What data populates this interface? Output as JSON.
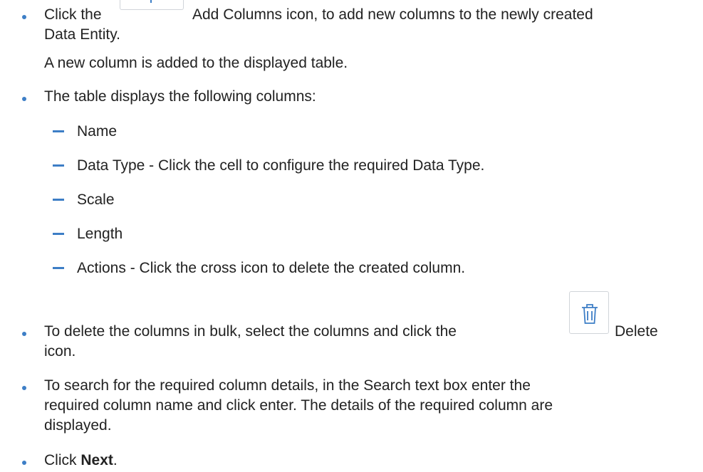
{
  "bullets": {
    "add_columns": {
      "pre": "Click the",
      "post": "Add Columns icon, to add new columns to the newly created",
      "line2": "Data Entity.",
      "line3": "A new column is added to the displayed table."
    },
    "table_columns": {
      "intro": "The table displays the following columns:",
      "items": [
        "Name",
        "Data Type - Click the cell to configure the required Data Type.",
        "Scale",
        "Length",
        "Actions - Click the cross icon to delete the created column."
      ]
    },
    "delete_bulk": {
      "pre": "To delete the columns in bulk, select the columns and click the",
      "post": "Delete",
      "line2": "icon."
    },
    "search": {
      "line1": "To search for the required column details, in the Search text box enter the",
      "line2": "required column name and click enter. The details of the required column are",
      "line3": "displayed."
    },
    "next": {
      "pre": "Click ",
      "bold": "Next",
      "post": "."
    }
  },
  "icons": {
    "add_columns": "add-columns-icon",
    "delete": "trash-icon"
  },
  "colors": {
    "bullet": "#3d7ec6",
    "icon_accent": "#3d7ec6"
  }
}
